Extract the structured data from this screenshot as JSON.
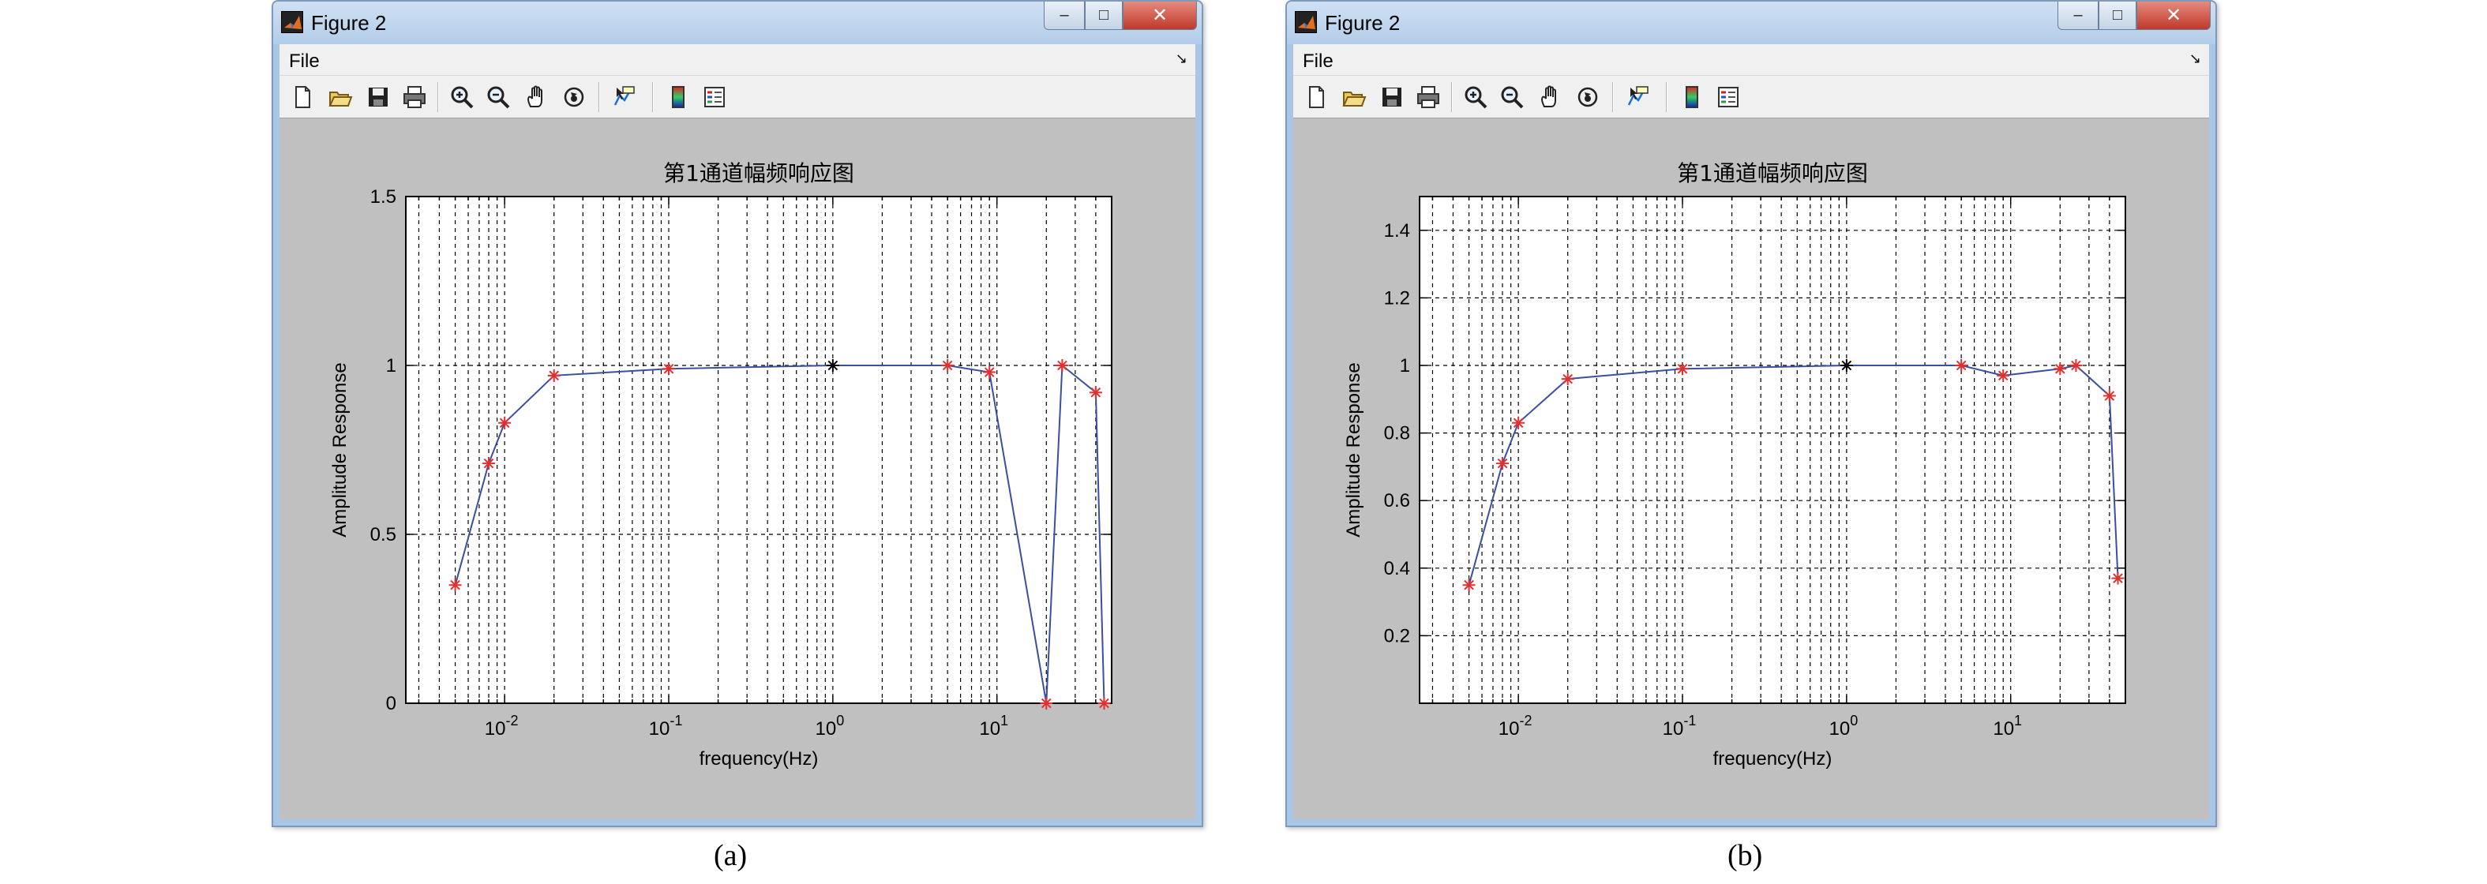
{
  "figures": [
    {
      "id": "a",
      "window_title": "Figure 2",
      "menu_file": "File",
      "menu_arrow": "↘",
      "caption": "(a)",
      "plot_title": "第1通道幅频响应图",
      "xlabel": "frequency(Hz)",
      "ylabel": "Amplitude Response"
    },
    {
      "id": "b",
      "window_title": "Figure 2",
      "menu_file": "File",
      "menu_arrow": "↘",
      "caption": "(b)",
      "plot_title": "第1通道幅频响应图",
      "xlabel": "frequency(Hz)",
      "ylabel": "Amplitude Response"
    }
  ],
  "toolbar_icons": [
    "new-file-icon",
    "open-folder-icon",
    "save-icon",
    "print-icon",
    "zoom-in-icon",
    "zoom-out-icon",
    "pan-hand-icon",
    "rotate-3d-icon",
    "data-cursor-icon",
    "colorbar-icon",
    "legend-icon"
  ],
  "window_icon": "matlab-logo-icon",
  "colors": {
    "line": "#3b4fa0",
    "marker": "#e03030",
    "reference_marker": "#000000",
    "axes_bg": "#ffffff",
    "figure_bg": "#c0c0c0",
    "titlebar": "#b9d1ea"
  },
  "chart_data": [
    {
      "type": "line",
      "xscale": "log",
      "xlim": [
        0.0025,
        50
      ],
      "ylim": [
        0,
        1.5
      ],
      "xticks": [
        0.01,
        0.1,
        1,
        10
      ],
      "xtick_labels": [
        {
          "base": "10",
          "exp": "-2"
        },
        {
          "base": "10",
          "exp": "-1"
        },
        {
          "base": "10",
          "exp": "0"
        },
        {
          "base": "10",
          "exp": "1"
        }
      ],
      "yticks": [
        0,
        0.5,
        1,
        1.5
      ],
      "ytick_labels": [
        "0",
        "0.5",
        "1",
        "1.5"
      ],
      "grid": "dashed",
      "title": "第1通道幅频响应图",
      "xlabel": "frequency(Hz)",
      "ylabel": "Amplitude Response",
      "series": [
        {
          "x": [
            0.005,
            0.008,
            0.01,
            0.02,
            0.1,
            1,
            5,
            9,
            20,
            25,
            40,
            45
          ],
          "y": [
            0.35,
            0.71,
            0.83,
            0.97,
            0.99,
            1.0,
            1.0,
            0.98,
            0.0,
            1.0,
            0.92,
            0.0
          ],
          "reference_index": 5
        }
      ]
    },
    {
      "type": "line",
      "xscale": "log",
      "xlim": [
        0.0025,
        50
      ],
      "ylim": [
        0,
        1.5
      ],
      "xticks": [
        0.01,
        0.1,
        1,
        10
      ],
      "xtick_labels": [
        {
          "base": "10",
          "exp": "-2"
        },
        {
          "base": "10",
          "exp": "-1"
        },
        {
          "base": "10",
          "exp": "0"
        },
        {
          "base": "10",
          "exp": "1"
        }
      ],
      "yticks": [
        0.2,
        0.4,
        0.6,
        0.8,
        1,
        1.2,
        1.4
      ],
      "ytick_labels": [
        "0.2",
        "0.4",
        "0.6",
        "0.8",
        "1",
        "1.2",
        "1.4"
      ],
      "grid": "dashed",
      "title": "第1通道幅频响应图",
      "xlabel": "frequency(Hz)",
      "ylabel": "Amplitude Response",
      "series": [
        {
          "x": [
            0.005,
            0.008,
            0.01,
            0.02,
            0.1,
            1,
            5,
            9,
            20,
            25,
            40,
            45
          ],
          "y": [
            0.35,
            0.71,
            0.83,
            0.96,
            0.99,
            1.0,
            1.0,
            0.97,
            0.99,
            1.0,
            0.91,
            0.37
          ],
          "reference_index": 5
        }
      ]
    }
  ]
}
